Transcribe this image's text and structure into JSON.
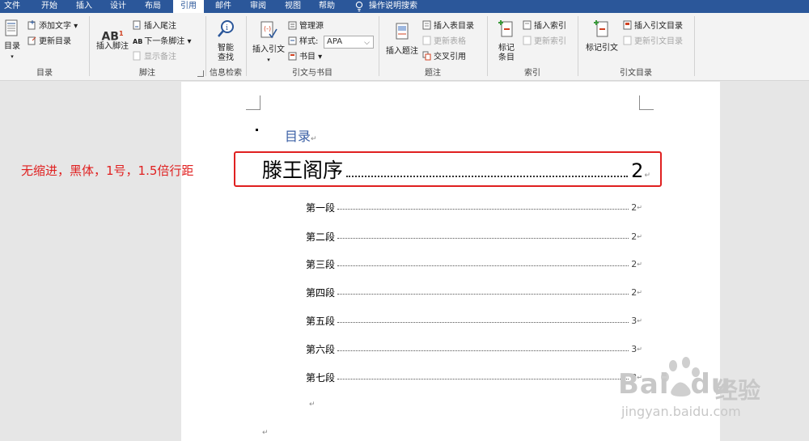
{
  "tabs": [
    {
      "label": "文件"
    },
    {
      "label": "开始"
    },
    {
      "label": "插入"
    },
    {
      "label": "设计"
    },
    {
      "label": "布局"
    },
    {
      "label": "引用",
      "active": true
    },
    {
      "label": "邮件"
    },
    {
      "label": "审阅"
    },
    {
      "label": "视图"
    },
    {
      "label": "帮助"
    },
    {
      "label": "操作说明搜索"
    }
  ],
  "ribbon": {
    "toc_group": {
      "label": "目录",
      "toc_button": "目录",
      "add_text": "添加文字",
      "update_toc": "更新目录"
    },
    "footnote_group": {
      "label": "脚注",
      "insert_footnote": "插入脚注",
      "insert_endnote": "插入尾注",
      "next_footnote": "下一条脚注",
      "show_notes": "显示备注"
    },
    "research_group": {
      "label": "信息检索",
      "smart_lookup_line1": "智能",
      "smart_lookup_line2": "查找"
    },
    "citation_group": {
      "label": "引文与书目",
      "insert_citation": "插入引文",
      "manage_sources": "管理源",
      "style_label": "样式:",
      "style_value": "APA",
      "bibliography": "书目"
    },
    "caption_group": {
      "label": "题注",
      "insert_caption": "插入题注",
      "insert_table_of_figures": "插入表目录",
      "update_table": "更新表格",
      "cross_reference": "交叉引用"
    },
    "index_group": {
      "label": "索引",
      "mark_entry_line1": "标记",
      "mark_entry_line2": "条目",
      "insert_index": "插入索引",
      "update_index": "更新索引"
    },
    "toa_group": {
      "label": "引文目录",
      "mark_citation": "标记引文",
      "insert_toa": "插入引文目录",
      "update_toa": "更新引文目录"
    }
  },
  "document": {
    "toc_heading": "目录",
    "paragraph_mark": "↵",
    "title_entry": {
      "text": "滕王阁序",
      "page": "2"
    },
    "entries": [
      {
        "text": "第一段",
        "page": "2"
      },
      {
        "text": "第二段",
        "page": "2"
      },
      {
        "text": "第三段",
        "page": "2"
      },
      {
        "text": "第四段",
        "page": "2"
      },
      {
        "text": "第五段",
        "page": "3"
      },
      {
        "text": "第六段",
        "page": "3"
      },
      {
        "text": "第七段",
        "page": "3"
      }
    ]
  },
  "annotation": "无缩进，黑体，1号，1.5倍行距",
  "watermark": {
    "brand": "Bai",
    "brand2": "du",
    "cn": "经验",
    "url": "jingyan.baidu.com"
  },
  "colors": {
    "tabbar": "#2b579a",
    "annotation": "#e02020",
    "toc_heading": "#3a5fa5"
  }
}
